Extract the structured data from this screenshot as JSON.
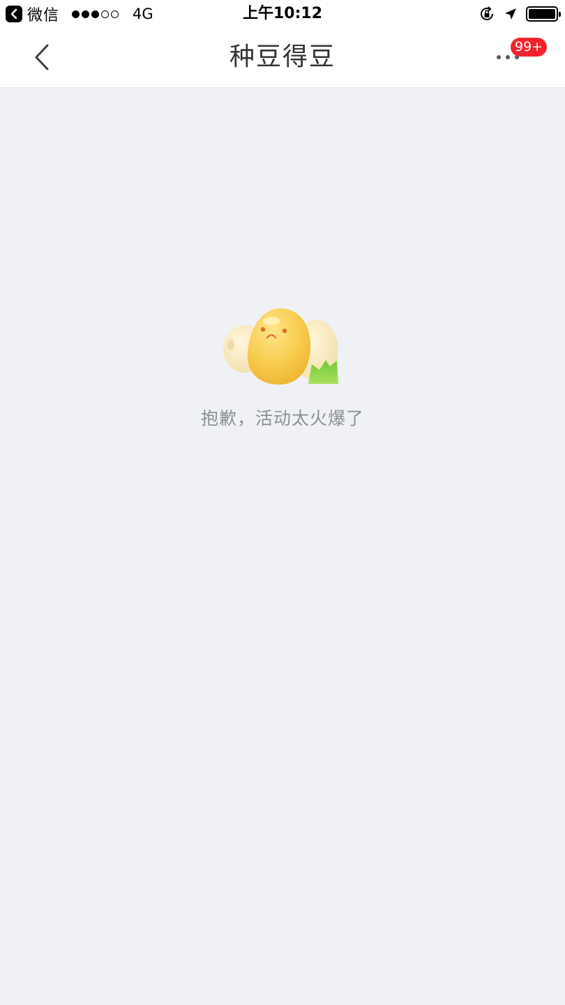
{
  "status_bar": {
    "back_app_label": "微信",
    "network": "4G",
    "time": "上午10:12",
    "signal_full": 3,
    "signal_total": 5
  },
  "nav": {
    "title": "种豆得豆",
    "badge": "99+",
    "back_icon": "chevron-left-icon",
    "more_icon": "more-dots-icon"
  },
  "empty": {
    "message": "抱歉，活动太火爆了",
    "illustration": "sad-bean-illustration"
  },
  "colors": {
    "background": "#eff1f5",
    "badge": "#f5222d",
    "title": "#333333",
    "message": "#8c8f96"
  }
}
